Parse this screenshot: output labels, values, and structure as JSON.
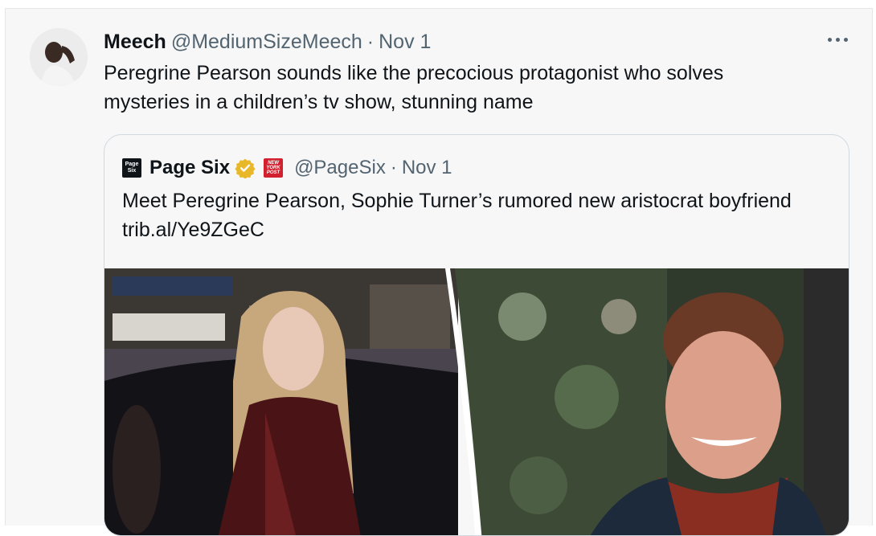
{
  "tweet": {
    "author_name": "Meech",
    "author_handle": "@MediumSizeMeech",
    "separator": "·",
    "date": "Nov 1",
    "text": "Peregrine Pearson sounds like the precocious protagonist who solves mysteries in a children’s tv show, stunning name",
    "more_icon": "more-horizontal-icon"
  },
  "quoted_tweet": {
    "logo_lines": [
      "Page",
      "Six"
    ],
    "author_name": "Page Six",
    "verified_badge": "gold-verified-badge-icon",
    "affiliate_logo_lines": [
      "NEW",
      "YORK",
      "POST"
    ],
    "author_handle": "@PageSix",
    "separator": "·",
    "date": "Nov 1",
    "text": "Meet Peregrine Pearson, Sophie Turner’s rumored new aristocrat boyfriend trib.al/Ye9ZGeC"
  },
  "colors": {
    "background": "#f7f7f7",
    "secondary_text": "#536471",
    "badge_gold": "#e8b829",
    "affiliate_red": "#d2202e"
  }
}
